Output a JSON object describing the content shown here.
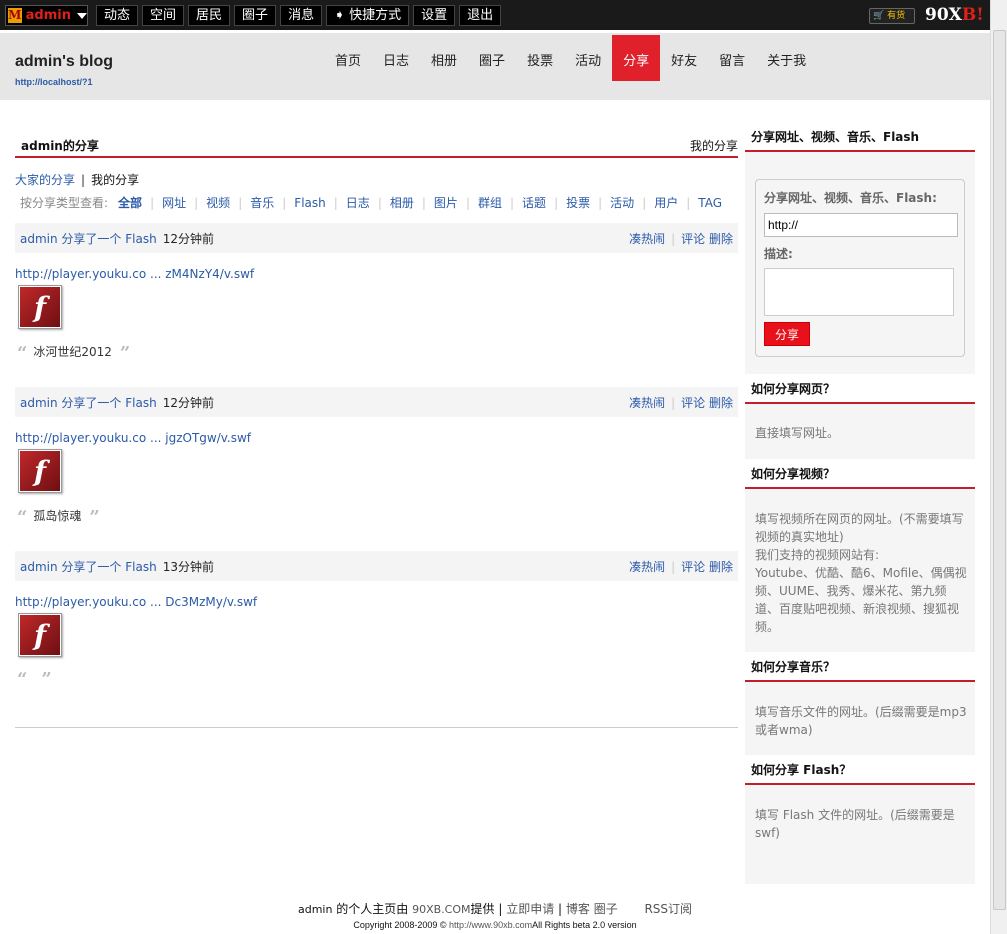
{
  "topbar": {
    "user": "admin",
    "logo_letter": "M",
    "nav": [
      "动态",
      "空间",
      "居民",
      "圈子",
      "消息",
      "➧ 快捷方式",
      "设置",
      "退出"
    ],
    "shop_label": "🛒 有货",
    "brand_a": "90X",
    "brand_b": "B!"
  },
  "header": {
    "title": "admin's blog",
    "url": "http://localhost/?1",
    "nav": [
      "首页",
      "日志",
      "相册",
      "圈子",
      "投票",
      "活动",
      "分享",
      "好友",
      "留言",
      "关于我"
    ],
    "active": "分享"
  },
  "main": {
    "section_title": "admin的分享",
    "section_right": "我的分享",
    "tab_all": "大家的分享",
    "tab_mine": "我的分享",
    "filter_label": "按分享类型查看:",
    "filters": [
      "全部",
      "网址",
      "视频",
      "音乐",
      "Flash",
      "日志",
      "相册",
      "图片",
      "群组",
      "话题",
      "投票",
      "活动",
      "用户",
      "TAG"
    ],
    "shares": [
      {
        "who": "admin 分享了一个 Flash",
        "time": "12分钟前",
        "link": "http://player.youku.co ... zM4NzY4/v.swf",
        "quote": "冰河世纪2012"
      },
      {
        "who": "admin 分享了一个 Flash",
        "time": "12分钟前",
        "link": "http://player.youku.co ... jgzOTgw/v.swf",
        "quote": "孤岛惊魂"
      },
      {
        "who": "admin 分享了一个 Flash",
        "time": "13分钟前",
        "link": "http://player.youku.co ... Dc3MzMy/v.swf",
        "quote": ""
      }
    ],
    "op_hot": "凑热闹",
    "op_comment": "评论",
    "op_delete": "删除",
    "flash_icon": "flash-player-icon",
    "flash_glyph": "f",
    "quote_open": "“",
    "quote_close": "”"
  },
  "sidebar": {
    "title": "分享网址、视频、音乐、Flash",
    "form_label": "分享网址、视频、音乐、Flash:",
    "input_value": "http://",
    "desc_label": "描述:",
    "button": "分享",
    "faq": [
      {
        "q": "如何分享网页？",
        "a": [
          "直接填写网址。"
        ]
      },
      {
        "q": "如何分享视频？",
        "a": [
          "填写视频所在网页的网址。(不需要填写视频的真实地址)",
          "我们支持的视频网站有:",
          "Youtube、优酷、酷6、Mofile、偶偶视频、UUME、我秀、爆米花、第九频道、百度贴吧视频、新浪视频、搜狐视频。"
        ]
      },
      {
        "q": "如何分享音乐？",
        "a": [
          "填写音乐文件的网址。(后缀需要是mp3或者wma)"
        ]
      },
      {
        "q": "如何分享 Flash？",
        "a": [
          "填写 Flash 文件的网址。(后缀需要是swf)"
        ]
      }
    ]
  },
  "footer": {
    "owner": "admin",
    "home_text": "的个人主页由",
    "provider": "90XB.COM",
    "provide_text": "提供",
    "links": [
      "立即申请",
      "博客",
      "圈子"
    ],
    "rss": "RSS订阅",
    "copyright": "Copyright 2008-2009 ©",
    "site": "http://www.90xb.com",
    "rights": "All Rights beta 2.0 version"
  }
}
